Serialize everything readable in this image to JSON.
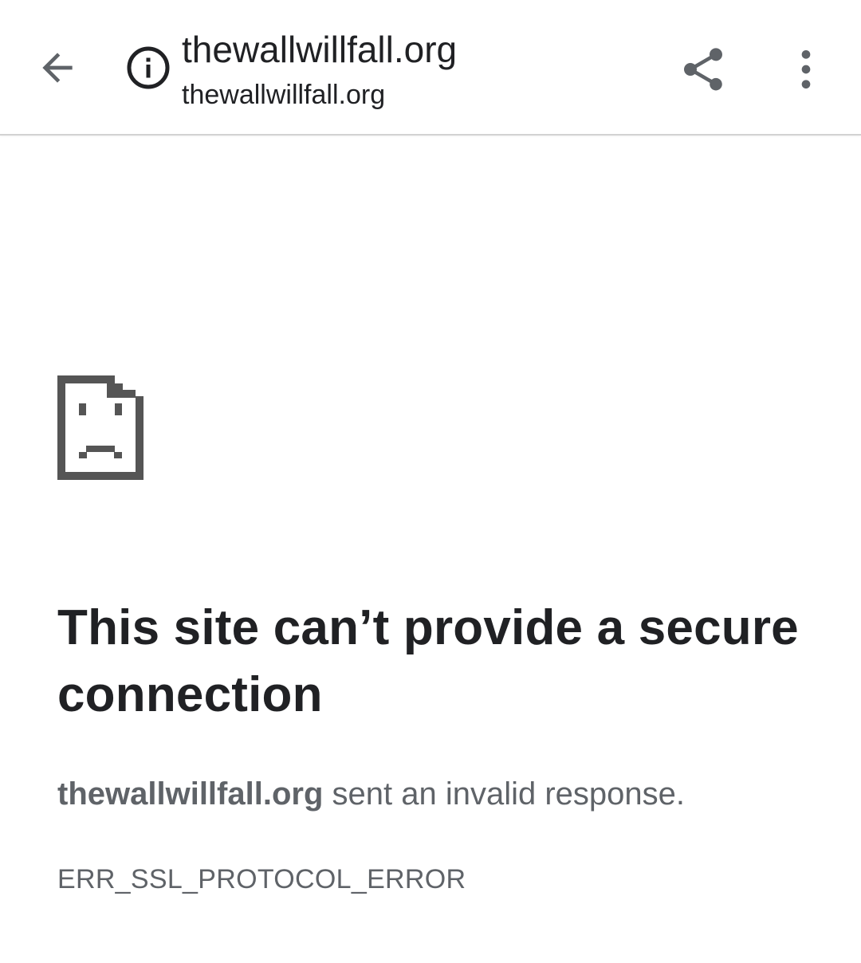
{
  "toolbar": {
    "back_icon": "arrow-left-icon",
    "info_icon": "info-circle-icon",
    "page_title": "thewallwillfall.org",
    "url": "thewallwillfall.org",
    "share_icon": "share-icon",
    "menu_icon": "more-vert-icon"
  },
  "error_page": {
    "icon": "sad-document-icon",
    "heading": "This site can’t provide a secure connection",
    "host": "thewallwillfall.org",
    "description_rest": " sent an invalid response.",
    "error_code": "ERR_SSL_PROTOCOL_ERROR"
  },
  "colors": {
    "text_primary": "#202124",
    "text_secondary": "#5f6368",
    "icon": "#5f6368",
    "toolbar_divider": "#d2d2d2"
  }
}
